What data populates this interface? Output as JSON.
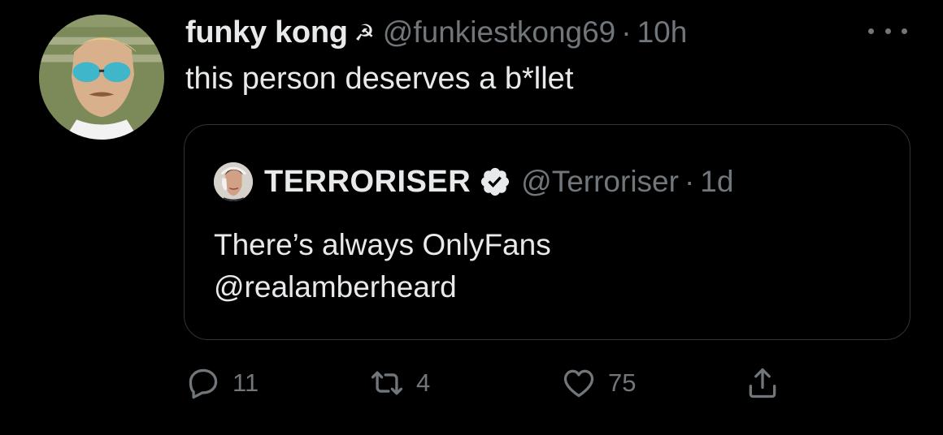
{
  "tweet": {
    "author": {
      "display_name": "funky kong",
      "name_emoji": "☭",
      "handle": "@funkiestkong69",
      "avatar": "avatar-photo"
    },
    "separator": "·",
    "time": "10h",
    "text": "this person deserves a b*llet",
    "more_icon": "more-horizontal-icon"
  },
  "quote": {
    "author": {
      "display_name": "TERRORISER",
      "verified": true,
      "handle": "@Terroriser",
      "avatar": "avatar-photo"
    },
    "separator": "·",
    "time": "1d",
    "text_lines": [
      "There’s always OnlyFans",
      "@realamberheard"
    ]
  },
  "actions": {
    "reply": {
      "icon": "reply-icon",
      "count": "11"
    },
    "retweet": {
      "icon": "retweet-icon",
      "count": "4"
    },
    "like": {
      "icon": "heart-icon",
      "count": "75"
    },
    "share": {
      "icon": "share-icon"
    }
  },
  "colors": {
    "background": "#000000",
    "text_primary": "#e7e9ea",
    "text_secondary": "#71767b",
    "border": "#2f3336"
  }
}
